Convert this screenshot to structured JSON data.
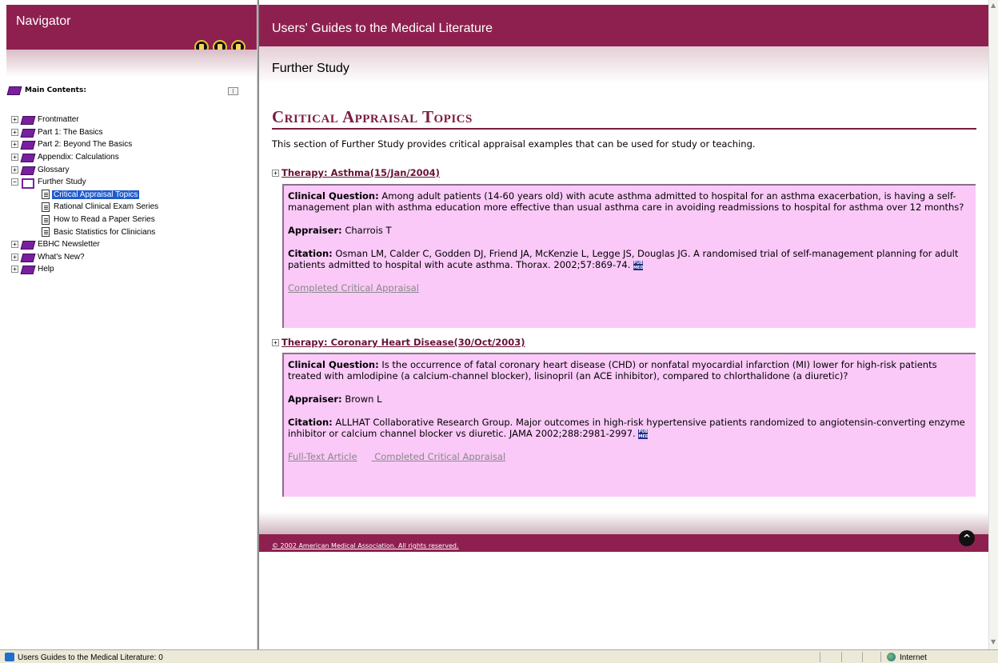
{
  "navigator": {
    "title": "Navigator",
    "tools": [
      "contents-book-icon",
      "index-book-icon",
      "search-binoculars-icon"
    ],
    "toc_title": "Main Contents:",
    "tree": [
      {
        "label": "Frontmatter",
        "expander": "+",
        "icon": "book-icon"
      },
      {
        "label": "Part 1: The Basics",
        "expander": "+",
        "icon": "book-icon"
      },
      {
        "label": "Part 2: Beyond The Basics",
        "expander": "+",
        "icon": "book-icon"
      },
      {
        "label": "Appendix: Calculations",
        "expander": "+",
        "icon": "book-icon"
      },
      {
        "label": "Glossary",
        "expander": "+",
        "icon": "book-icon"
      },
      {
        "label": "Further Study",
        "expander": "−",
        "icon": "open-book-icon",
        "children": [
          {
            "label": "Critical Appraisal Topics",
            "selected": true
          },
          {
            "label": "Rational Clinical Exam Series"
          },
          {
            "label": "How to Read a Paper Series"
          },
          {
            "label": "Basic Statistics for Clinicians"
          }
        ]
      },
      {
        "label": "EBHC Newsletter",
        "expander": "+",
        "icon": "book-icon"
      },
      {
        "label": "What's New?",
        "expander": "+",
        "icon": "book-icon"
      },
      {
        "label": "Help",
        "expander": "+",
        "icon": "book-icon"
      }
    ]
  },
  "content": {
    "title": "Users' Guides to the Medical Literature",
    "section": "Further Study",
    "heading": "Critical Appraisal Topics",
    "intro": "This section of Further Study provides critical appraisal examples that can be used for study or teaching.",
    "topics": [
      {
        "title": "Therapy: Asthma(15/Jan/2004)",
        "question_label": "Clinical Question:",
        "question": "Among adult patients (14-60 years old) with acute asthma admitted to hospital for an asthma exacerbation, is having a self-management plan with asthma education more effective than usual asthma care in avoiding readmissions to hospital for asthma over 12 months?",
        "appraiser_label": "Appraiser:",
        "appraiser": "Charrois T",
        "citation_label": "Citation:",
        "citation": "Osman LM, Calder C, Godden DJ, Friend JA, McKenzie L, Legge JS, Douglas JG. A randomised trial of self-management planning for adult patients admitted to hospital with acute asthma. Thorax. 2002;57:869-74.",
        "pubmed": "PUB MED",
        "links": [
          "Completed Critical Appraisal"
        ]
      },
      {
        "title": "Therapy: Coronary Heart Disease(30/Oct/2003)",
        "question_label": "Clinical Question:",
        "question": "Is the occurrence of fatal coronary heart disease (CHD) or nonfatal myocardial infarction (MI) lower for high-risk patients treated with amlodipine (a calcium-channel blocker), lisinopril (an ACE inhibitor), compared to chlorthalidone (a diuretic)?",
        "appraiser_label": "Appraiser:",
        "appraiser": "Brown L",
        "citation_label": "Citation:",
        "citation": "ALLHAT Collaborative Research Group. Major outcomes in high-risk hypertensive patients randomized to angiotensin-converting enzyme inhibitor or calcium channel blocker vs diuretic. JAMA 2002;288:2981-2997.",
        "pubmed": "PUB MED",
        "links": [
          "Full-Text Article",
          "Completed Critical Appraisal"
        ]
      }
    ],
    "copyright": "© 2002 American Medical Association. All rights reserved.",
    "top_icon": "back-to-top-icon"
  },
  "statusbar": {
    "text": "Users Guides to the Medical Literature: 0",
    "zone": "Internet"
  },
  "colors": {
    "brand": "#8e2050",
    "heading": "#7a1c42",
    "card_bg": "#fac9f8",
    "selection": "#1f5bcc"
  }
}
